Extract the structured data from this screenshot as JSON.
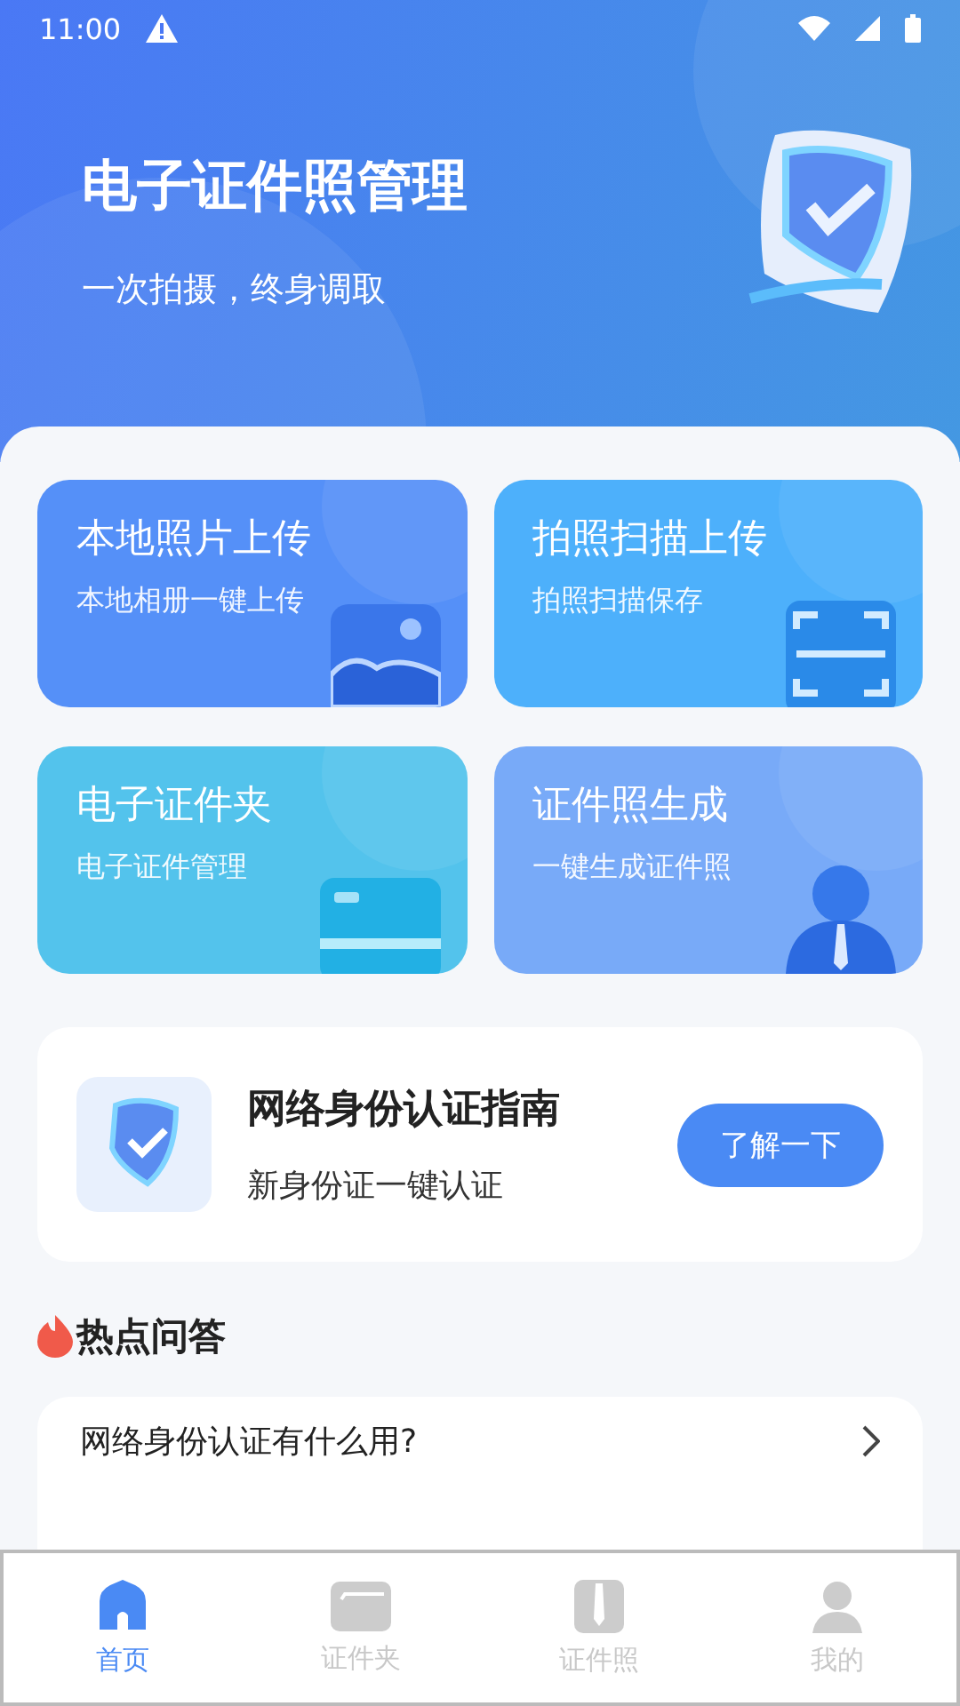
{
  "status_bar": {
    "time": "11:00"
  },
  "header": {
    "title": "电子证件照管理",
    "subtitle": "一次拍摄，终身调取"
  },
  "features": [
    {
      "kind": "album",
      "title": "本地照片上传",
      "subtitle": "本地相册一键上传",
      "color": "#5590f8"
    },
    {
      "kind": "scan",
      "title": "拍照扫描上传",
      "subtitle": "拍照扫描保存",
      "color": "#4db0fb"
    },
    {
      "kind": "card",
      "title": "电子证件夹",
      "subtitle": "电子证件管理",
      "color": "#53c3ec"
    },
    {
      "kind": "person",
      "title": "证件照生成",
      "subtitle": "一键生成证件照",
      "color": "#78aaf8"
    }
  ],
  "guide": {
    "title": "网络身份认证指南",
    "subtitle": "新身份证一键认证",
    "button": "了解一下"
  },
  "hot": {
    "title": "热点问答",
    "items": [
      {
        "question": "网络身份认证有什么用?"
      }
    ]
  },
  "tabs": [
    {
      "label": "首页",
      "kind": "home",
      "selected": true
    },
    {
      "label": "证件夹",
      "kind": "folder",
      "selected": false
    },
    {
      "label": "证件照",
      "kind": "id",
      "selected": false
    },
    {
      "label": "我的",
      "kind": "me",
      "selected": false
    }
  ]
}
